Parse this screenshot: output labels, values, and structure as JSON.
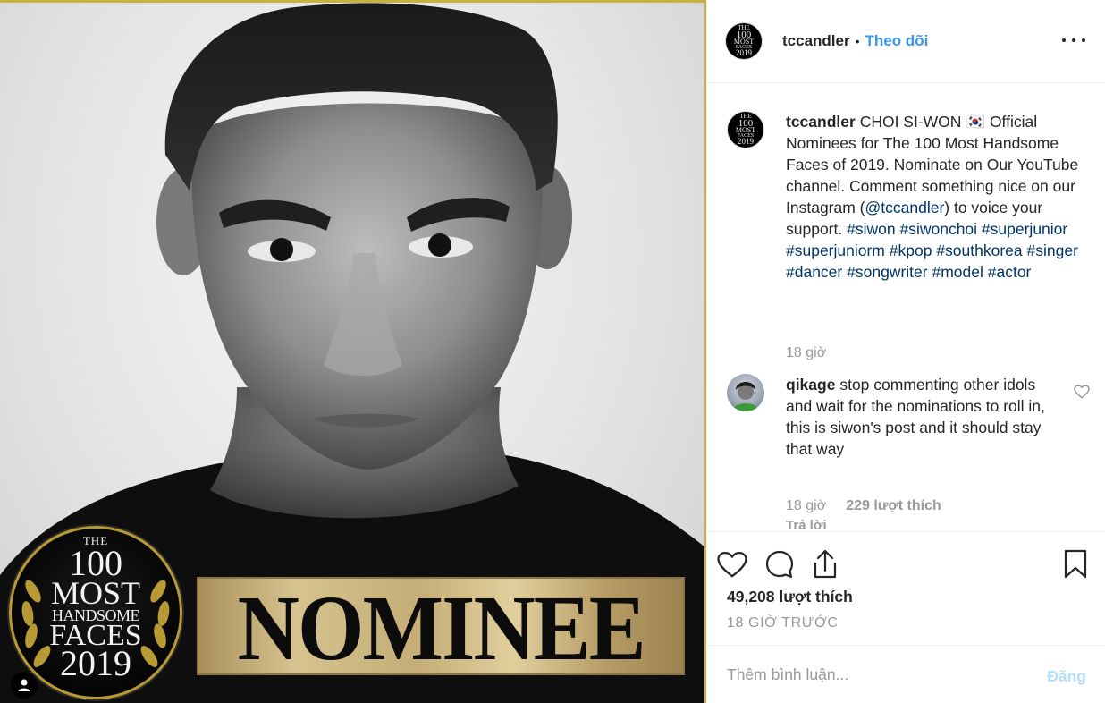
{
  "photo": {
    "logo_the": "THE",
    "logo_num": "100",
    "logo_most": "MOST",
    "logo_handsome": "HANDSOME",
    "logo_faces": "FACES",
    "logo_year": "2019",
    "nominee_text": "NOMINEE",
    "tag_icon": "user-icon"
  },
  "header": {
    "username": "tccandler",
    "separator": "•",
    "follow_label": "Theo dõi",
    "more_icon": "more-options-icon"
  },
  "caption": {
    "username": "tccandler",
    "text_before_mention": "CHOI SI-WON 🇰🇷 Official Nominees for The 100 Most Handsome Faces of 2019. Nominate on Our YouTube channel. Comment something nice on our Instagram (",
    "mention": "@tccandler",
    "text_after_mention": ") to voice your support.",
    "hashtags": [
      "#siwon",
      "#siwonchoi",
      "#superjunior",
      "#superjuniorm",
      "#kpop",
      "#southkorea",
      "#singer",
      "#dancer",
      "#songwriter",
      "#model",
      "#actor"
    ],
    "time": "18 giờ"
  },
  "comment": {
    "username": "qikage",
    "text": "stop commenting other idols and wait for the nominations to roll in, this is siwon's post and it should stay that way",
    "time": "18 giờ",
    "likes": "229 lượt thích",
    "reply_label": "Trả lời"
  },
  "actions": {
    "likes_count": "49,208 lượt thích",
    "post_time": "18 GIỜ TRƯỚC"
  },
  "add_comment": {
    "placeholder": "Thêm bình luận...",
    "post_label": "Đăng"
  },
  "colors": {
    "link_blue": "#3897f0",
    "hashtag": "#003569",
    "muted": "#999999",
    "post_disabled": "#b2dffc",
    "gold": "#c9b240"
  }
}
